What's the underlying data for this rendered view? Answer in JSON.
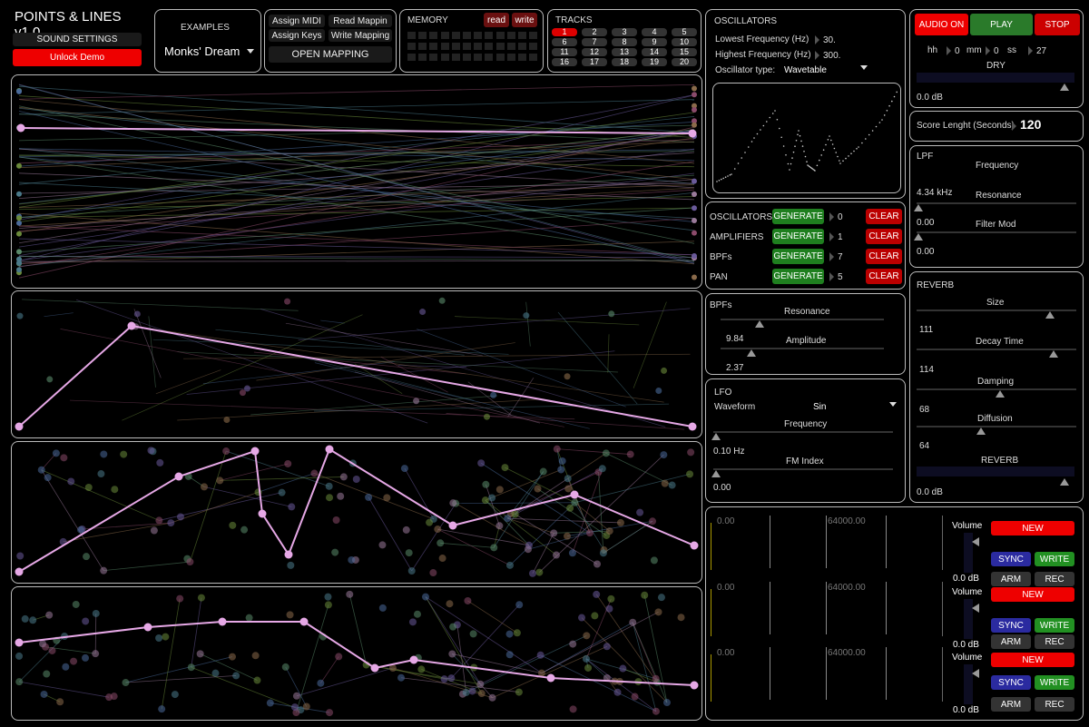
{
  "app": {
    "title": "POINTS & LINES v1.0",
    "sound_settings": "SOUND SETTINGS",
    "unlock": "Unlock Demo"
  },
  "examples": {
    "label": "EXAMPLES",
    "selected": "Monks' Dream"
  },
  "mapping": {
    "assign_midi": "Assign MIDI",
    "read_mapping": "Read Mappin",
    "assign_keys": "Assign Keys",
    "write_mapping": "Write Mapping",
    "open_mapping": "OPEN MAPPING"
  },
  "memory": {
    "label": "MEMORY",
    "read": "read",
    "write": "write"
  },
  "tracks": {
    "label": "TRACKS",
    "items": [
      "1",
      "2",
      "3",
      "4",
      "5",
      "6",
      "7",
      "8",
      "9",
      "10",
      "11",
      "12",
      "13",
      "14",
      "15",
      "16",
      "17",
      "18",
      "19",
      "20"
    ],
    "selected": "1"
  },
  "oscillators": {
    "title": "OSCILLATORS",
    "lowest_label": "Lowest Frequency (Hz)",
    "lowest": "30.",
    "highest_label": "Highest Frequency (Hz)",
    "highest": "300.",
    "type_label": "Oscillator type:",
    "type": "Wavetable"
  },
  "generate": {
    "rows": [
      {
        "label": "OSCILLATORS",
        "gen": "GENERATE",
        "value": "0",
        "clear": "CLEAR"
      },
      {
        "label": "AMPLIFIERS",
        "gen": "GENERATE",
        "value": "1",
        "clear": "CLEAR"
      },
      {
        "label": "BPFs",
        "gen": "GENERATE",
        "value": "7",
        "clear": "CLEAR"
      },
      {
        "label": "PAN",
        "gen": "GENERATE",
        "value": "5",
        "clear": "CLEAR"
      }
    ]
  },
  "bpfs": {
    "title": "BPFs",
    "resonance_label": "Resonance",
    "resonance": "9.84",
    "amplitude_label": "Amplitude",
    "amplitude": "2.37"
  },
  "lfo": {
    "title": "LFO",
    "waveform_label": "Waveform",
    "waveform": "Sin",
    "frequency_label": "Frequency",
    "frequency": "0.10 Hz",
    "fm_label": "FM Index",
    "fm": "0.00"
  },
  "transport": {
    "audio_on": "AUDIO ON",
    "play": "PLAY",
    "stop": "STOP",
    "hh_label": "hh",
    "hh": "0",
    "mm_label": "mm",
    "mm": "0",
    "ss_label": "ss",
    "ss": "27",
    "dry_label": "DRY",
    "dry": "0.0 dB"
  },
  "score": {
    "label": "Score Lenght (Seconds)",
    "value": "120"
  },
  "lpf": {
    "title": "LPF",
    "frequency_label": "Frequency",
    "frequency": "4.34 kHz",
    "resonance_label": "Resonance",
    "resonance": "0.00",
    "filter_mod_label": "Filter Mod",
    "filter_mod": "0.00"
  },
  "reverb": {
    "title": "REVERB",
    "size_label": "Size",
    "size": "111",
    "decay_label": "Decay Time",
    "decay": "114",
    "damping_label": "Damping",
    "damping": "68",
    "diffusion_label": "Diffusion",
    "diffusion": "64",
    "reverb_label": "REVERB",
    "reverb": "0.0 dB"
  },
  "recorders": [
    {
      "start": "0.00",
      "end": "64000.00",
      "volume_label": "Volume",
      "volume": "0.0 dB",
      "new": "NEW",
      "sync": "SYNC",
      "write": "WRITE",
      "arm": "ARM",
      "rec": "REC"
    },
    {
      "start": "0.00",
      "end": "64000.00",
      "volume_label": "Volume",
      "volume": "0.0 dB",
      "new": "NEW",
      "sync": "SYNC",
      "write": "WRITE",
      "arm": "ARM",
      "rec": "REC"
    },
    {
      "start": "0.00",
      "end": "64000.00",
      "volume_label": "Volume",
      "volume": "0.0 dB",
      "new": "NEW",
      "sync": "SYNC",
      "write": "WRITE",
      "arm": "ARM",
      "rec": "REC"
    }
  ],
  "colors": {
    "accent_red": "#ee0000",
    "play_green": "#2a7a2a",
    "highlight_line": "#e6a8e6",
    "sync_blue": "#2b2ba0"
  }
}
